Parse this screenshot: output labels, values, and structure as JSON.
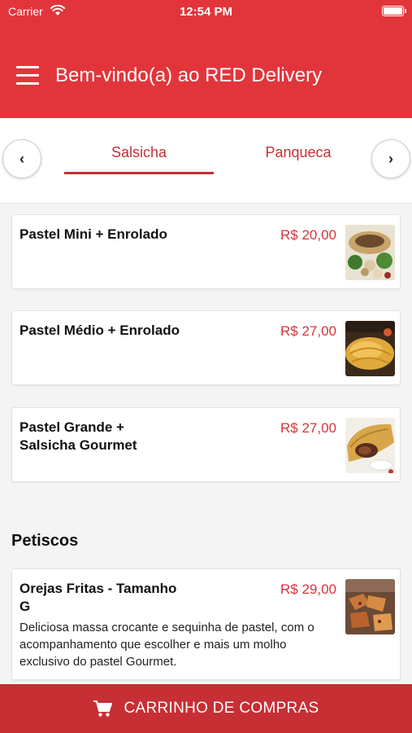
{
  "status_bar": {
    "carrier": "Carrier",
    "time": "12:54 PM"
  },
  "header": {
    "title": "Bem-vindo(a) ao RED Delivery"
  },
  "tabs": {
    "prev_label": "‹",
    "next_label": "›",
    "items": [
      {
        "label": "Salsicha",
        "selected": true
      },
      {
        "label": "Panqueca",
        "selected": false
      }
    ]
  },
  "products": [
    {
      "name": "Pastel Mini + Enrolado",
      "price": "R$ 20,00"
    },
    {
      "name": "Pastel Médio + Enrolado",
      "price": "R$ 27,00"
    },
    {
      "name": "Pastel Grande + Salsicha Gourmet",
      "price": "R$ 27,00"
    }
  ],
  "section": {
    "title": "Petiscos",
    "items": [
      {
        "name": "Orejas Fritas - Tamanho G",
        "price": "R$ 29,00",
        "description": "Deliciosa massa crocante e sequinha de pastel, com o acompanhamento que escolher e mais um molho exclusivo do pastel Gourmet."
      }
    ]
  },
  "cart": {
    "label": "CARRINHO DE COMPRAS"
  },
  "colors": {
    "brand_red": "#e2353b",
    "accent_red": "#c62f34",
    "price_red": "#d8343a"
  }
}
